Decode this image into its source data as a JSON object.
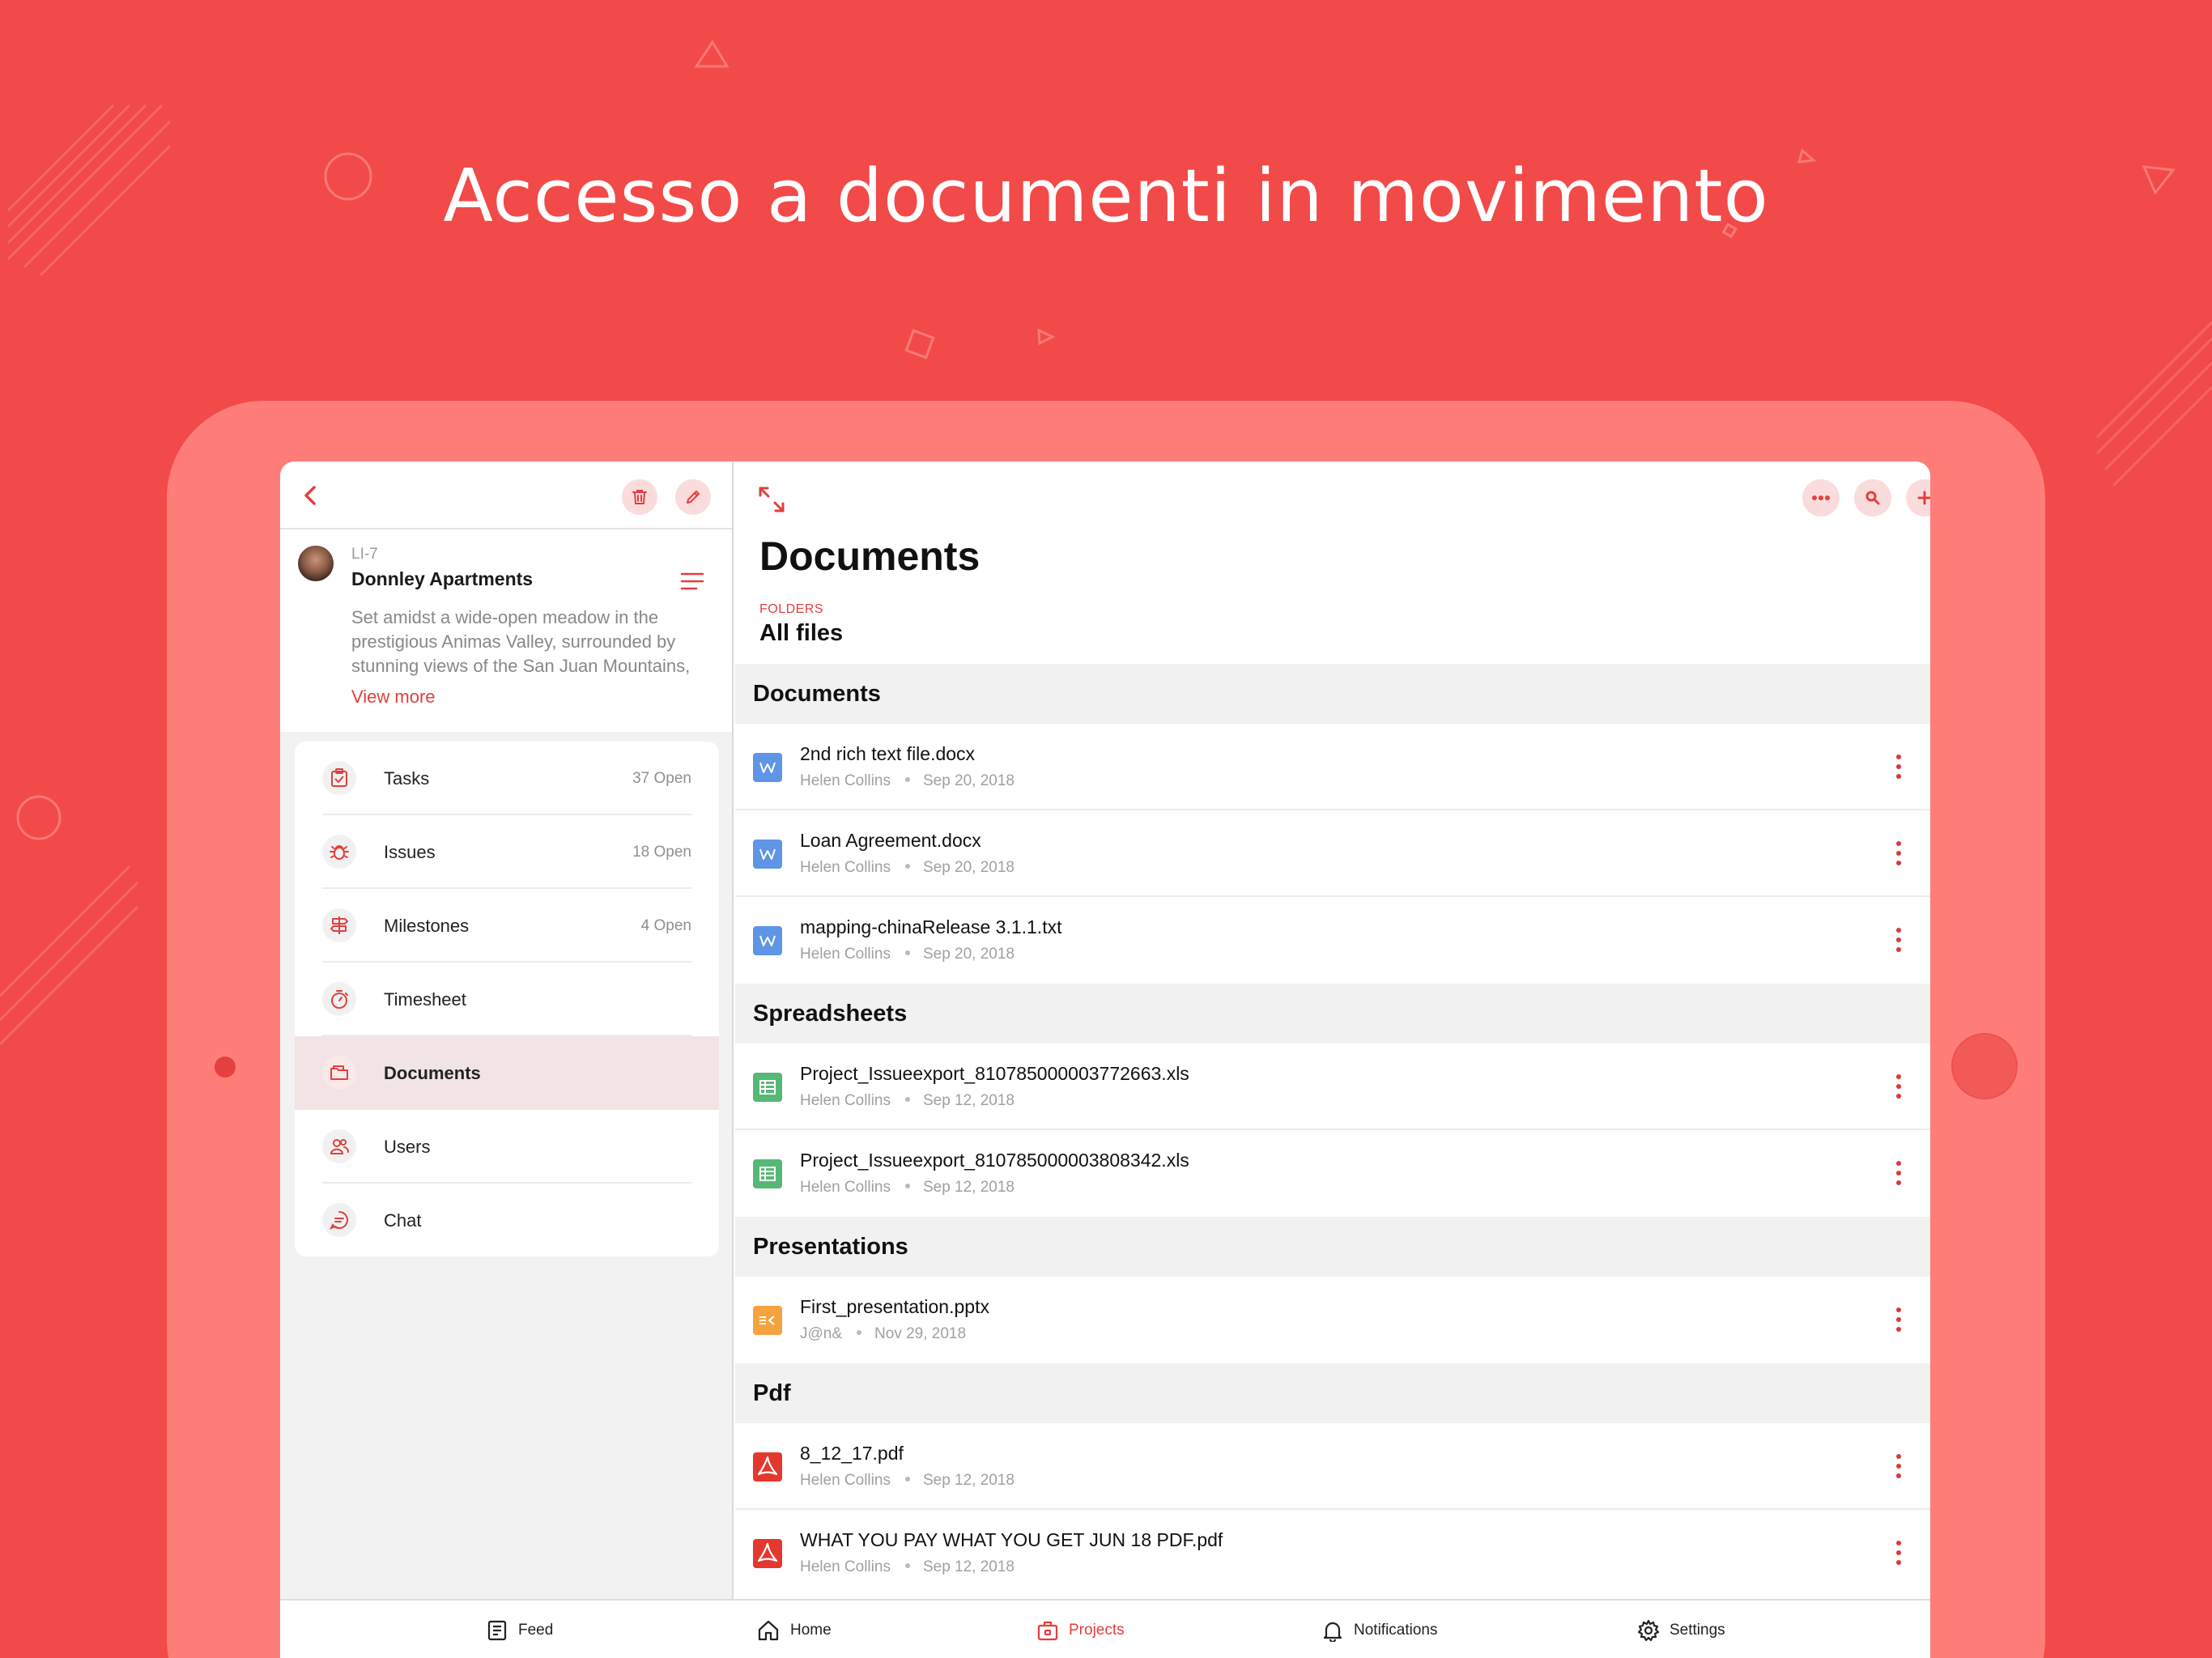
{
  "headline": "Accesso a documenti in movimento",
  "colors": {
    "accent": "#e23f3c",
    "background": "#f24a48",
    "device": "#ff7d79"
  },
  "left_pane": {
    "back_icon": "chevron-left-icon",
    "delete_icon": "trash-icon",
    "edit_icon": "pencil-icon",
    "project": {
      "code": "LI-7",
      "name": "Donnley Apartments",
      "description_lines": [
        "Set amidst a wide-open meadow in the",
        "prestigious Animas Valley, surrounded by",
        "stunning views of the San Juan Mountains,"
      ],
      "view_more": "View more"
    },
    "menu": [
      {
        "label": "Tasks",
        "count": "37 Open",
        "icon": "task-check-icon"
      },
      {
        "label": "Issues",
        "count": "18 Open",
        "icon": "bug-icon"
      },
      {
        "label": "Milestones",
        "count": "4 Open",
        "icon": "signpost-icon"
      },
      {
        "label": "Timesheet",
        "count": "",
        "icon": "stopwatch-icon"
      },
      {
        "label": "Documents",
        "count": "",
        "icon": "folder-icon",
        "active": true
      },
      {
        "label": "Users",
        "count": "",
        "icon": "users-icon"
      },
      {
        "label": "Chat",
        "count": "",
        "icon": "chat-icon"
      }
    ]
  },
  "right_pane": {
    "title": "Documents",
    "folders_label": "FOLDERS",
    "folder_name": "All files",
    "sections": [
      {
        "title": "Documents",
        "files": [
          {
            "name": "2nd rich text file.docx",
            "owner": "Helen Collins",
            "date": "Sep 20, 2018",
            "type": "word"
          },
          {
            "name": "Loan Agreement.docx",
            "owner": "Helen Collins",
            "date": "Sep 20, 2018",
            "type": "word"
          },
          {
            "name": "mapping-chinaRelease 3.1.1.txt",
            "owner": "Helen Collins",
            "date": "Sep 20, 2018",
            "type": "word"
          }
        ]
      },
      {
        "title": "Spreadsheets",
        "files": [
          {
            "name": "Project_Issueexport_810785000003772663.xls",
            "owner": "Helen Collins",
            "date": "Sep 12, 2018",
            "type": "sheet"
          },
          {
            "name": "Project_Issueexport_810785000003808342.xls",
            "owner": "Helen Collins",
            "date": "Sep 12, 2018",
            "type": "sheet"
          }
        ]
      },
      {
        "title": "Presentations",
        "files": [
          {
            "name": "First_presentation.pptx",
            "owner": "J@n&",
            "date": "Nov 29, 2018",
            "type": "slide"
          }
        ]
      },
      {
        "title": "Pdf",
        "files": [
          {
            "name": "8_12_17.pdf",
            "owner": "Helen Collins",
            "date": "Sep 12, 2018",
            "type": "pdf"
          },
          {
            "name": "WHAT YOU PAY WHAT YOU GET JUN 18 PDF.pdf",
            "owner": "Helen Collins",
            "date": "Sep 12, 2018",
            "type": "pdf"
          }
        ]
      }
    ]
  },
  "tabbar": [
    {
      "label": "Feed",
      "icon": "feed-icon"
    },
    {
      "label": "Home",
      "icon": "home-icon"
    },
    {
      "label": "Projects",
      "icon": "briefcase-icon",
      "active": true
    },
    {
      "label": "Notifications",
      "icon": "bell-icon"
    },
    {
      "label": "Settings",
      "icon": "gear-icon"
    }
  ]
}
